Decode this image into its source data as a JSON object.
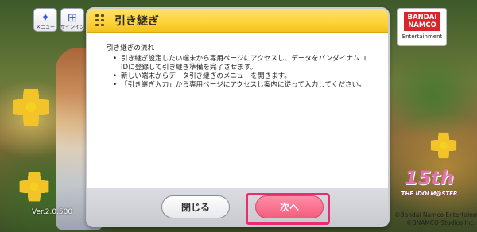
{
  "game": {
    "menu_button": {
      "label": "メニュー",
      "icon": "butterfly-icon"
    },
    "signin_button": {
      "label": "サインイン",
      "icon": "gamepad-icon"
    },
    "logo": {
      "line1": "BANDAI",
      "line2": "NAMCO",
      "line3": "Entertainment"
    },
    "anniversary": {
      "mark": "15th",
      "sub": "THE IDOLM@STER"
    },
    "version": "Ver.2.0.500",
    "copyright": [
      "©Bandai Namco Entertainment Inc.",
      "©BNAMCO Studios Inc."
    ]
  },
  "dialog": {
    "title": "引き継ぎ",
    "heading": "引き継ぎの流れ",
    "steps": [
      "引き継ぎ設定したい端末から専用ページにアクセスし、データをバンダイナムコIDに登録して引き継ぎ準備を完了させます。",
      "新しい端末からデータ引き継ぎのメニューを開きます。",
      "「引き継ぎ入力」から専用ページにアクセスし案内に従って入力してください。"
    ],
    "close_label": "閉じる",
    "next_label": "次へ"
  },
  "colors": {
    "header": "#ffd23a",
    "next_button": "#f45d7e",
    "highlight": "#ea2d6e"
  }
}
